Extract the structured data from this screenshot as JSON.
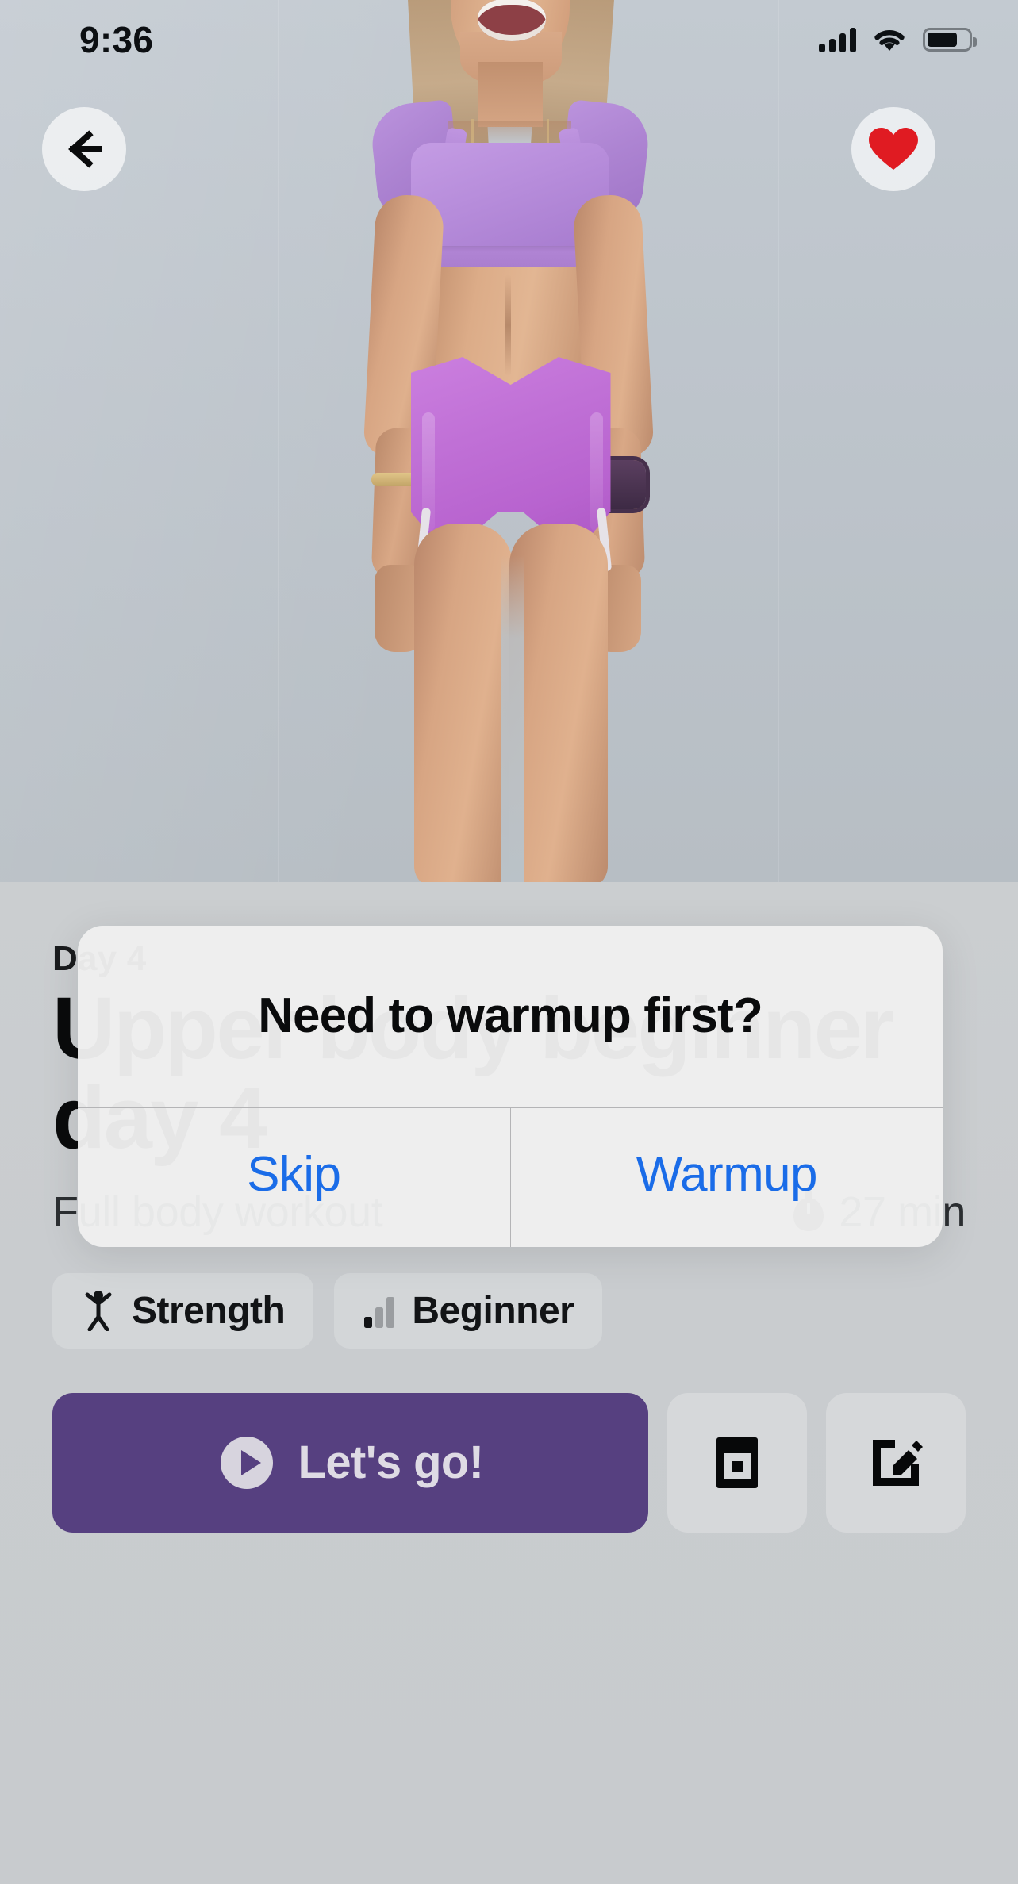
{
  "status_bar": {
    "time": "9:36",
    "cellular_icon": "signal-bars-icon",
    "wifi_icon": "wifi-icon",
    "battery_icon": "battery-icon"
  },
  "header": {
    "back_icon": "back-arrow-icon",
    "favorite_icon": "heart-filled-icon",
    "favorite_color": "#e01b22"
  },
  "workout": {
    "eyebrow": "Day 4",
    "title": "Upper body beginner day 4",
    "subtitle": "Full body workout",
    "duration": "27 min",
    "duration_icon": "stopwatch-icon",
    "tags": [
      {
        "label": "Strength",
        "icon": "strength-figure-icon"
      },
      {
        "label": "Beginner",
        "icon": "difficulty-bars-icon"
      }
    ]
  },
  "actions": {
    "primary_label": "Let's go!",
    "primary_icon": "play-circle-icon",
    "primary_color": "#564080",
    "cast_icon": "picture-in-picture-icon",
    "edit_icon": "edit-square-icon"
  },
  "alert": {
    "title": "Need to warmup first?",
    "buttons": [
      {
        "label": "Skip"
      },
      {
        "label": "Warmup"
      }
    ],
    "button_color": "#1a6ce8"
  }
}
